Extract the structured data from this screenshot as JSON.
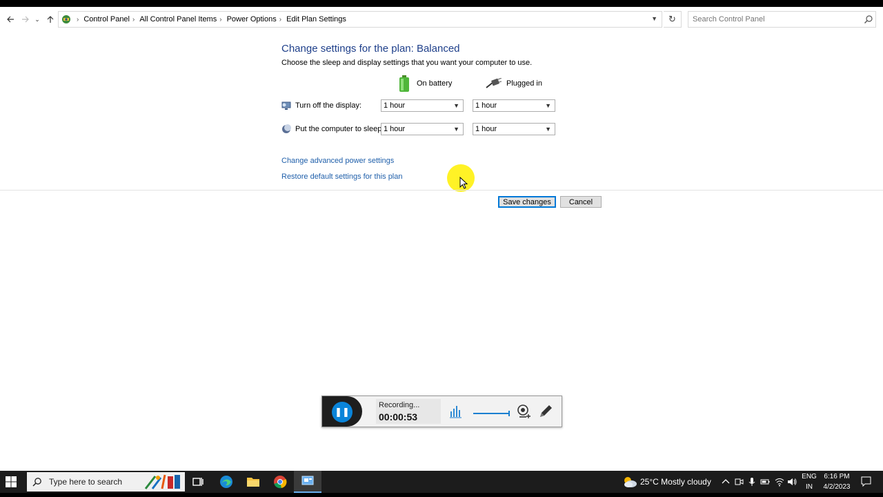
{
  "navigation": {
    "breadcrumbs": [
      "Control Panel",
      "All Control Panel Items",
      "Power Options",
      "Edit Plan Settings"
    ],
    "search_placeholder": "Search Control Panel"
  },
  "plan": {
    "title": "Change settings for the plan: Balanced",
    "subtitle": "Choose the sleep and display settings that you want your computer to use.",
    "columns": {
      "battery": "On battery",
      "plugged": "Plugged in"
    },
    "rows": [
      {
        "label": "Turn off the display:",
        "battery": "1 hour",
        "plugged": "1 hour"
      },
      {
        "label": "Put the computer to sleep:",
        "battery": "1 hour",
        "plugged": "1 hour"
      }
    ],
    "links": {
      "advanced": "Change advanced power settings",
      "restore": "Restore default settings for this plan"
    },
    "buttons": {
      "save": "Save changes",
      "cancel": "Cancel"
    }
  },
  "recorder": {
    "status": "Recording...",
    "time": "00:00:53"
  },
  "taskbar": {
    "search_placeholder": "Type here to search",
    "weather": "25°C  Mostly cloudy",
    "language": "ENG",
    "region": "IN",
    "time": "6:16 PM",
    "date": "4/2/2023"
  },
  "colors": {
    "link": "#1f5faa",
    "title": "#1e3f8a",
    "accent": "#0078d7"
  }
}
